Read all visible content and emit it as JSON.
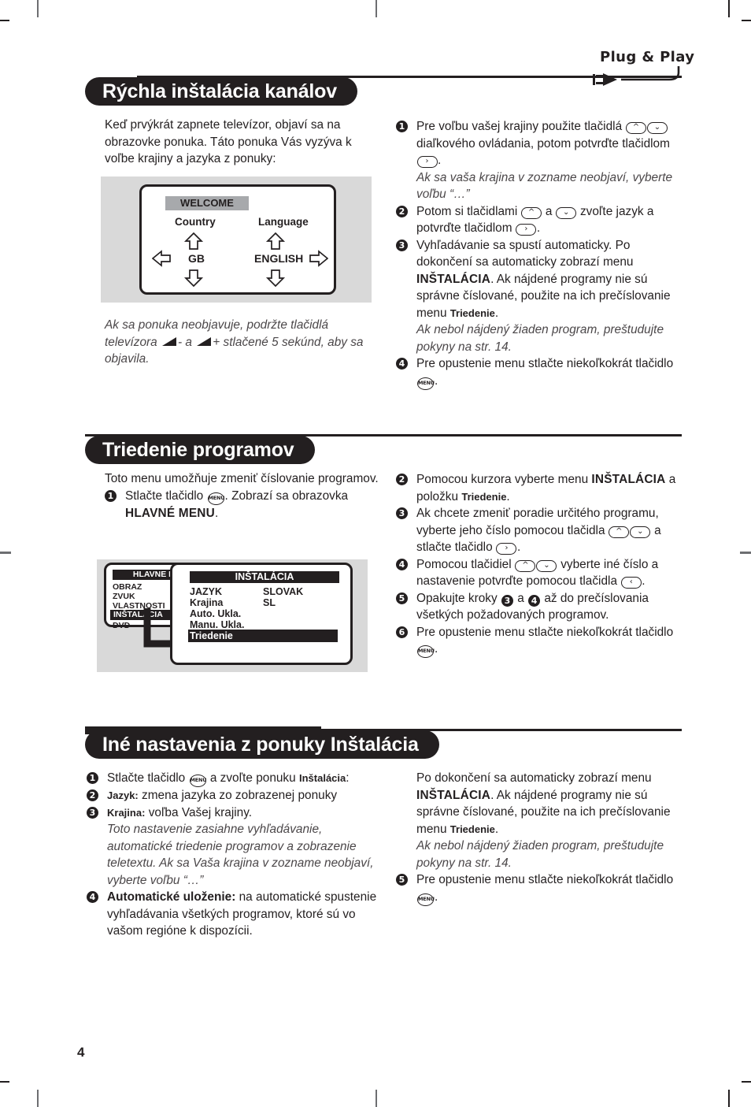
{
  "page": {
    "number": "4",
    "logo": "Plug & Play"
  },
  "sections": [
    {
      "id": "quick-install",
      "title": "Rýchla inštalácia kanálov",
      "intro": "Keď prvýkrát zapnete televízor, objaví sa na obrazovke ponuka. Táto ponuka Vás vyzýva k voľbe krajiny a jazyka z ponuky:",
      "note": {
        "pre": "Ak sa ponuka neobjavuje, podržte tlačidlá televízora",
        "mid": "- a",
        "post": "+ stlačené 5 sekúnd, aby sa objavila."
      },
      "figure": {
        "title": "WELCOME",
        "col1_label": "Country",
        "col1_value": "GB",
        "col2_label": "Language",
        "col2_value": "ENGLISH"
      },
      "steps": [
        {
          "n": "1",
          "t1": "Pre voľbu vašej krajiny použite tlačidlá",
          "k1": "up",
          "k2": "down",
          "t2": "diaľkového ovládania, potom potvrďte tlačidlom",
          "k3": "right",
          "t3": ".",
          "note": "Ak sa vaša krajina v zozname neobjaví, vyberte voľbu “…”"
        },
        {
          "n": "2",
          "t1": "Potom si tlačidlami",
          "k1": "up",
          "t2": "a",
          "k2": "down",
          "t3": "zvoľte jazyk a potvrďte tlačidlom",
          "k3": "right",
          "t4": "."
        },
        {
          "n": "3",
          "t1": "Vyhľadávanie sa spustí automaticky.",
          "t2": "Po dokončení sa automaticky zobrazí menu",
          "b1": "INŠTALÁCIA",
          "t3": ". Ak nájdené programy nie sú správne číslované, použite na ich prečíslovanie menu",
          "b2": "Triedenie",
          "t4": ".",
          "note": "Ak nebol nájdený žiaden program, preštudujte pokyny na str. 14."
        },
        {
          "n": "4",
          "t1": "Pre opustenie menu stlačte niekoľkokrát tlačidlo",
          "k1": "menu",
          "t2": "."
        }
      ]
    },
    {
      "id": "sort-programs",
      "title": "Triedenie programov",
      "intro": "Toto menu umožňuje zmeniť číslovanie programov.",
      "figure": {
        "main_title": "HLAVNE MENU",
        "main_items": [
          "OBRAZ",
          "ZVUK",
          "VLASTNOSTI",
          "INŠTALACIA",
          "DVD"
        ],
        "main_selected": "INŠTALACIA",
        "sub_title": "INŠTALÁCIA",
        "sub_items": [
          {
            "label": "JAZYK",
            "value": "SLOVAK"
          },
          {
            "label": "Krajina",
            "value": "SL"
          },
          {
            "label": "Auto. Ukla.",
            "value": ""
          },
          {
            "label": "Manu. Ukla.",
            "value": ""
          }
        ],
        "sub_selected": "Triedenie"
      },
      "steps_left": [
        {
          "n": "1",
          "t1": "Stlačte tlačidlo",
          "k1": "menu",
          "t2": ". Zobrazí sa obrazovka",
          "b1": "HLAVNÉ MENU",
          "t3": "."
        }
      ],
      "steps_right": [
        {
          "n": "2",
          "t1": "Pomocou kurzora vyberte menu",
          "b1": "INŠTALÁCIA",
          "t2": "a položku",
          "b2": "Triedenie",
          "t3": "."
        },
        {
          "n": "3",
          "t1": "Ak chcete zmeniť poradie určitého programu, vyberte jeho číslo pomocou tlačidla",
          "k1": "up",
          "k2": "down",
          "t2": "a stlačte tlačidlo",
          "k3": "right",
          "t3": "."
        },
        {
          "n": "4",
          "t1": "Pomocou tlačidiel",
          "k1": "up",
          "k2": "down",
          "t2": "vyberte iné číslo a nastavenie potvrďte pomocou tlačidla",
          "k3": "left",
          "t3": "."
        },
        {
          "n": "5",
          "t1": "Opakujte kroky",
          "n1": "3",
          "t2": "a",
          "n2": "4",
          "t3": "až do prečíslovania všetkých požadovaných programov."
        },
        {
          "n": "6",
          "t1": "Pre opustenie menu stlačte niekoľkokrát tlačidlo",
          "k1": "menu",
          "t2": "."
        }
      ]
    },
    {
      "id": "other-settings",
      "title": "Iné nastavenia z ponuky Inštalácia",
      "steps_left": [
        {
          "n": "1",
          "t1": "Stlačte tlačidlo",
          "k1": "menu",
          "t2": "a zvoľte ponuku",
          "b1": "Inštalácia",
          "t3": ":"
        },
        {
          "n": "2",
          "b1": "Jazyk:",
          "t1": "zmena jazyka zo zobrazenej ponuky"
        },
        {
          "n": "3",
          "b1": "Krajina:",
          "t1": "voľba Vašej krajiny.",
          "note": "Toto nastavenie zasiahne vyhľadávanie, automatické triedenie programov a zobrazenie teletextu. Ak sa Vaša krajina v zozname neobjaví, vyberte voľbu “…”"
        },
        {
          "n": "4",
          "b1": "Automatické uloženie:",
          "t1": "na automatické spustenie vyhľadávania všetkých programov, ktoré sú vo vašom regióne k dispozícii."
        }
      ],
      "steps_right": [
        {
          "n": "",
          "t1": "Po dokončení sa automaticky zobrazí menu",
          "b1": "INŠTALÁCIA",
          "t2": ". Ak nájdené programy nie sú správne číslované, použite na ich prečíslovanie menu",
          "b2": "Triedenie",
          "t3": ".",
          "note": "Ak nebol nájdený žiaden program, preštudujte pokyny na str. 14."
        },
        {
          "n": "5",
          "t1": "Pre opustenie menu stlačte niekoľkokrát tlačidlo",
          "k1": "menu",
          "t2": "."
        }
      ]
    }
  ],
  "colors": {
    "ink": "#231f20",
    "figure_bg": "#d9d9d9",
    "osd_gray": "#a7a9ac"
  }
}
